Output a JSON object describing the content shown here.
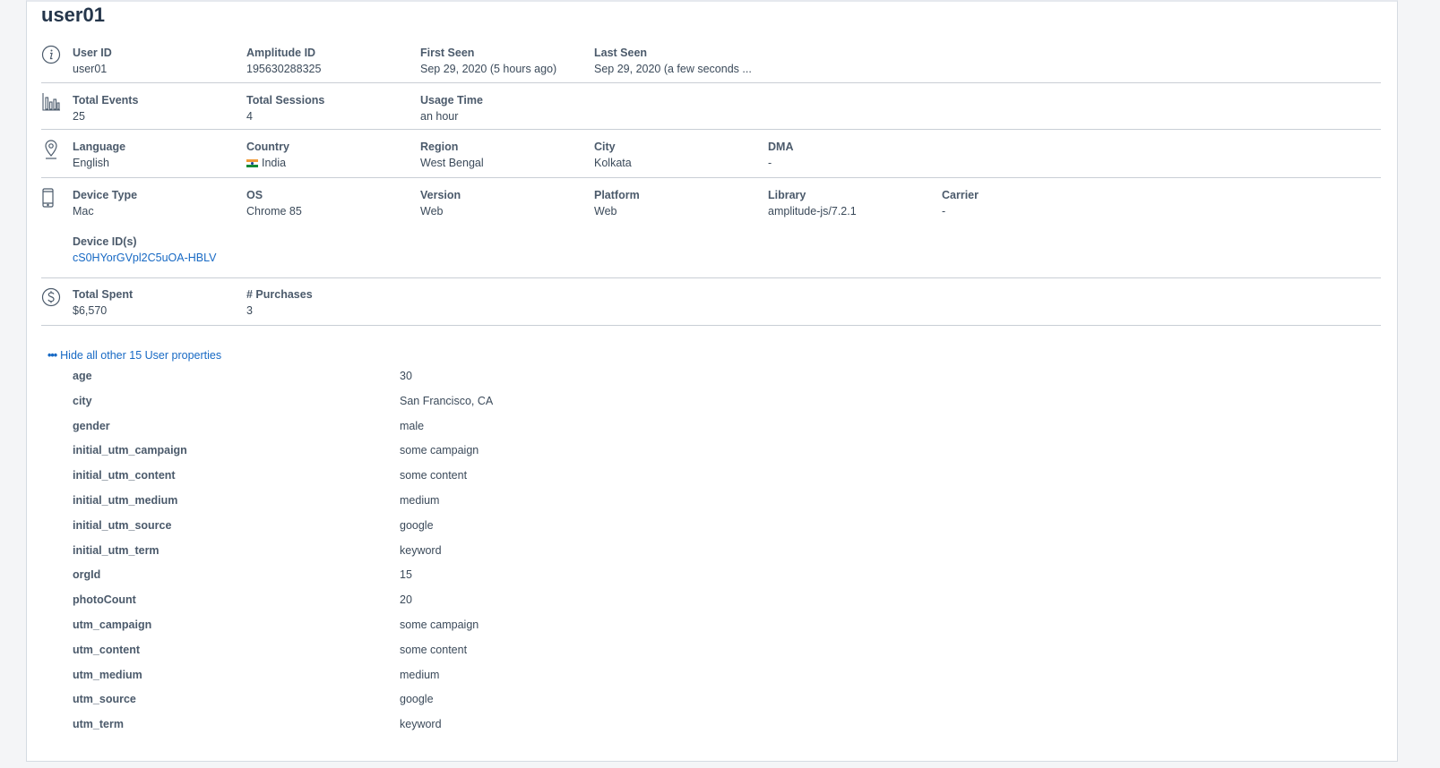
{
  "user_title": "user01",
  "identity": {
    "icon": "info-icon",
    "fields": [
      {
        "label": "User ID",
        "value": "user01"
      },
      {
        "label": "Amplitude ID",
        "value": "195630288325"
      },
      {
        "label": "First Seen",
        "value": "Sep 29, 2020 (5 hours ago)"
      },
      {
        "label": "Last Seen",
        "value": "Sep 29, 2020 (a few seconds ..."
      }
    ]
  },
  "usage": {
    "icon": "bar-chart-icon",
    "fields": [
      {
        "label": "Total Events",
        "value": "25"
      },
      {
        "label": "Total Sessions",
        "value": "4"
      },
      {
        "label": "Usage Time",
        "value": "an hour"
      }
    ]
  },
  "location": {
    "icon": "location-pin-icon",
    "fields": [
      {
        "label": "Language",
        "value": "English"
      },
      {
        "label": "Country",
        "value": "India",
        "flag": "india-flag-icon"
      },
      {
        "label": "Region",
        "value": "West Bengal"
      },
      {
        "label": "City",
        "value": "Kolkata"
      },
      {
        "label": "DMA",
        "value": "-"
      }
    ]
  },
  "device": {
    "icon": "mobile-device-icon",
    "fields": [
      {
        "label": "Device Type",
        "value": "Mac"
      },
      {
        "label": "OS",
        "value": "Chrome 85"
      },
      {
        "label": "Version",
        "value": "Web"
      },
      {
        "label": "Platform",
        "value": "Web"
      },
      {
        "label": "Library",
        "value": "amplitude-js/7.2.1"
      },
      {
        "label": "Carrier",
        "value": "-"
      }
    ],
    "device_ids_label": "Device ID(s)",
    "device_ids_value": "cS0HYorGVpl2C5uOA-HBLV"
  },
  "revenue": {
    "icon": "dollar-circle-icon",
    "fields": [
      {
        "label": "Total Spent",
        "value": "$6,570"
      },
      {
        "label": "# Purchases",
        "value": "3"
      }
    ]
  },
  "toggle_label": "Hide all other 15 User properties",
  "toggle_icon": "more-dots-icon",
  "user_properties": [
    {
      "key": "age",
      "value": "30"
    },
    {
      "key": "city",
      "value": "San Francisco, CA"
    },
    {
      "key": "gender",
      "value": "male"
    },
    {
      "key": "initial_utm_campaign",
      "value": "some campaign"
    },
    {
      "key": "initial_utm_content",
      "value": "some content"
    },
    {
      "key": "initial_utm_medium",
      "value": "medium"
    },
    {
      "key": "initial_utm_source",
      "value": "google"
    },
    {
      "key": "initial_utm_term",
      "value": "keyword"
    },
    {
      "key": "orgId",
      "value": "15"
    },
    {
      "key": "photoCount",
      "value": "20"
    },
    {
      "key": "utm_campaign",
      "value": "some campaign"
    },
    {
      "key": "utm_content",
      "value": "some content"
    },
    {
      "key": "utm_medium",
      "value": "medium"
    },
    {
      "key": "utm_source",
      "value": "google"
    },
    {
      "key": "utm_term",
      "value": "keyword"
    }
  ]
}
